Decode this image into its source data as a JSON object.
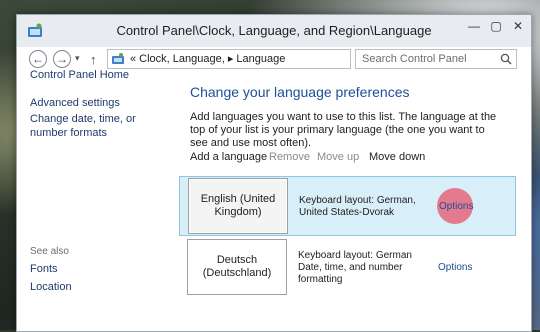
{
  "window": {
    "title": "Control Panel\\Clock, Language, and Region\\Language",
    "buttons": {
      "minimize": "—",
      "maximize": "▢",
      "close": "✕"
    }
  },
  "nav": {
    "back_icon": "back-arrow-icon",
    "forward_icon": "forward-arrow-icon",
    "dropdown_icon": "chevron-down-icon",
    "up_icon": "up-arrow-icon",
    "address": "« Clock, Language, ▸ Language",
    "search_placeholder": "Search Control Panel"
  },
  "sidebar": {
    "home": "Control Panel Home",
    "advanced": "Advanced settings",
    "date_time": "Change date, time, or number formats",
    "see_also": "See also",
    "fonts": "Fonts",
    "location": "Location"
  },
  "main": {
    "title": "Change your language preferences",
    "description": "Add languages you want to use to this list. The language at the top of your list is your primary language (the one you want to see and use most often).",
    "toolbar": {
      "add": "Add a language",
      "remove": "Remove",
      "move_up": "Move up",
      "move_down": "Move down"
    },
    "languages": [
      {
        "name": "English (United Kingdom)",
        "details": "Keyboard layout: German, United States-Dvorak",
        "options": "Options",
        "selected": true
      },
      {
        "name": "Deutsch (Deutschland)",
        "details": "Keyboard layout: German Date, time, and number formatting",
        "options": "Options",
        "selected": false
      }
    ]
  },
  "colors": {
    "link": "#1e3b6e",
    "heading": "#1e4f94",
    "selected_row": "#d8eef8",
    "click_marker": "#e65a6e"
  }
}
